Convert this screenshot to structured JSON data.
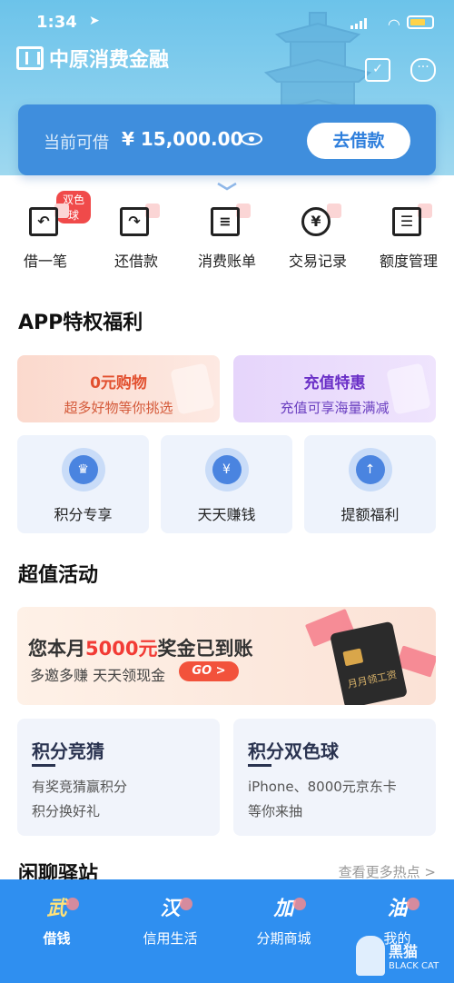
{
  "status_bar": {
    "time": "1:34"
  },
  "brand": {
    "name": "中原消费金融"
  },
  "credit": {
    "label": "当前可借",
    "amount": "¥ 15,000.00",
    "button": "去借款"
  },
  "actions": [
    {
      "label": "借一笔",
      "icon": "borrow-icon",
      "badge": "双色球"
    },
    {
      "label": "还借款",
      "icon": "repay-icon"
    },
    {
      "label": "消费账单",
      "icon": "bill-icon"
    },
    {
      "label": "交易记录",
      "icon": "yen-record-icon"
    },
    {
      "label": "额度管理",
      "icon": "quota-icon"
    }
  ],
  "privileges": {
    "title": "APP特权福利",
    "promos": [
      {
        "title": "0元购物",
        "subtitle": "超多好物等你挑选"
      },
      {
        "title": "充值特惠",
        "subtitle": "充值可享海量满减"
      }
    ],
    "perks": [
      {
        "label": "积分专享",
        "icon": "crown-icon"
      },
      {
        "label": "天天赚钱",
        "icon": "yen-ticket-icon"
      },
      {
        "label": "提额福利",
        "icon": "money-bag-icon"
      }
    ]
  },
  "activities": {
    "title": "超值活动",
    "bonus": {
      "headline_pre": "您本月",
      "headline_highlight": "5000元",
      "headline_post": "奖金已到账",
      "subline": "多邀多赚 天天领现金",
      "go": "GO >",
      "card_text": "月月领工资"
    },
    "games": [
      {
        "title": "积分竞猜",
        "line1": "有奖竞猜赢积分",
        "line2": "积分换好礼"
      },
      {
        "title": "积分双色球",
        "line1": "iPhone、8000元京东卡",
        "line2": "等你来抽"
      }
    ]
  },
  "chat": {
    "title": "闲聊驿站",
    "more": "查看更多热点 >"
  },
  "tabs": [
    {
      "glyph": "武",
      "label": "借钱",
      "active": true
    },
    {
      "glyph": "汉",
      "label": "信用生活"
    },
    {
      "glyph": "加",
      "label": "分期商城"
    },
    {
      "glyph": "油",
      "label": "我的"
    }
  ],
  "watermark": {
    "text": "黑猫",
    "sub": "BLACK CAT"
  },
  "colors": {
    "primary": "#2f8ff0",
    "card": "#3f8edd",
    "accent_red": "#f23b35"
  }
}
